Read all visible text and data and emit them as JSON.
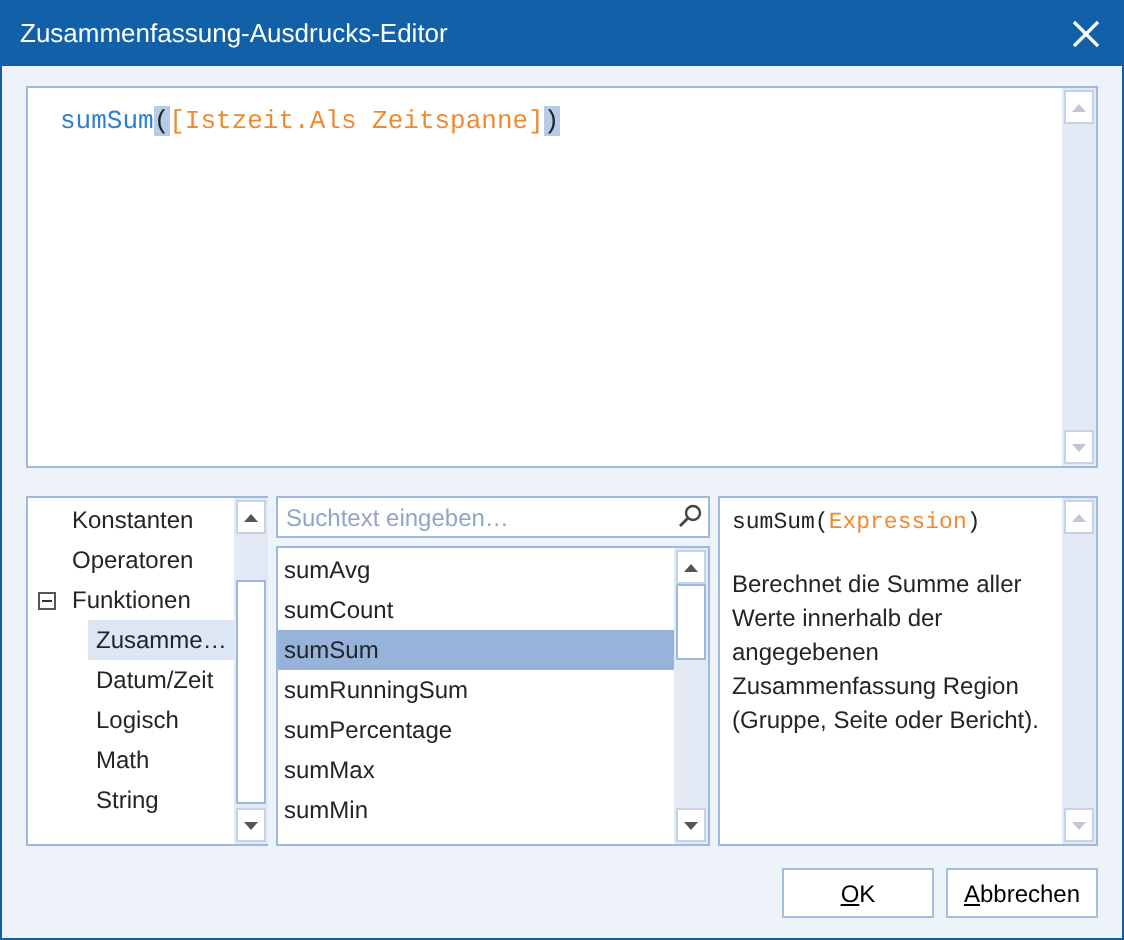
{
  "window": {
    "title": "Zusammenfassung-Ausdrucks-Editor"
  },
  "expression": {
    "tokens": [
      {
        "kind": "function",
        "text": "sumSum",
        "highlighted": false
      },
      {
        "kind": "paren",
        "text": "(",
        "highlighted": true
      },
      {
        "kind": "field",
        "text": "[Istzeit.Als Zeitspanne]",
        "highlighted": false
      },
      {
        "kind": "paren",
        "text": ")",
        "highlighted": true
      }
    ]
  },
  "categories": [
    {
      "label": "Konstanten",
      "selected": false
    },
    {
      "label": "Operatoren",
      "selected": false
    },
    {
      "label": "Funktionen",
      "selected": false,
      "expanded": true,
      "children": [
        {
          "label": "Zusamme…",
          "selected": true
        },
        {
          "label": "Datum/Zeit",
          "selected": false
        },
        {
          "label": "Logisch",
          "selected": false
        },
        {
          "label": "Math",
          "selected": false
        },
        {
          "label": "String",
          "selected": false
        }
      ]
    }
  ],
  "search": {
    "placeholder": "Suchtext eingeben…"
  },
  "functions": [
    {
      "label": "sumAvg",
      "selected": false
    },
    {
      "label": "sumCount",
      "selected": false
    },
    {
      "label": "sumSum",
      "selected": true
    },
    {
      "label": "sumRunningSum",
      "selected": false
    },
    {
      "label": "sumPercentage",
      "selected": false
    },
    {
      "label": "sumMax",
      "selected": false
    },
    {
      "label": "sumMin",
      "selected": false
    }
  ],
  "help": {
    "signature": [
      {
        "kind": "function",
        "text": "sumSum"
      },
      {
        "kind": "paren",
        "text": "("
      },
      {
        "kind": "field",
        "text": "Expression"
      },
      {
        "kind": "paren",
        "text": ")"
      }
    ],
    "description": "Berechnet die Summe aller Werte innerhalb der angegebenen Zusammenfassung Region (Gruppe, Seite oder Bericht)."
  },
  "buttons": [
    {
      "label": "OK",
      "access_key_underlined": true
    },
    {
      "label": "Abbrechen",
      "access_key_underlined": true
    }
  ]
}
